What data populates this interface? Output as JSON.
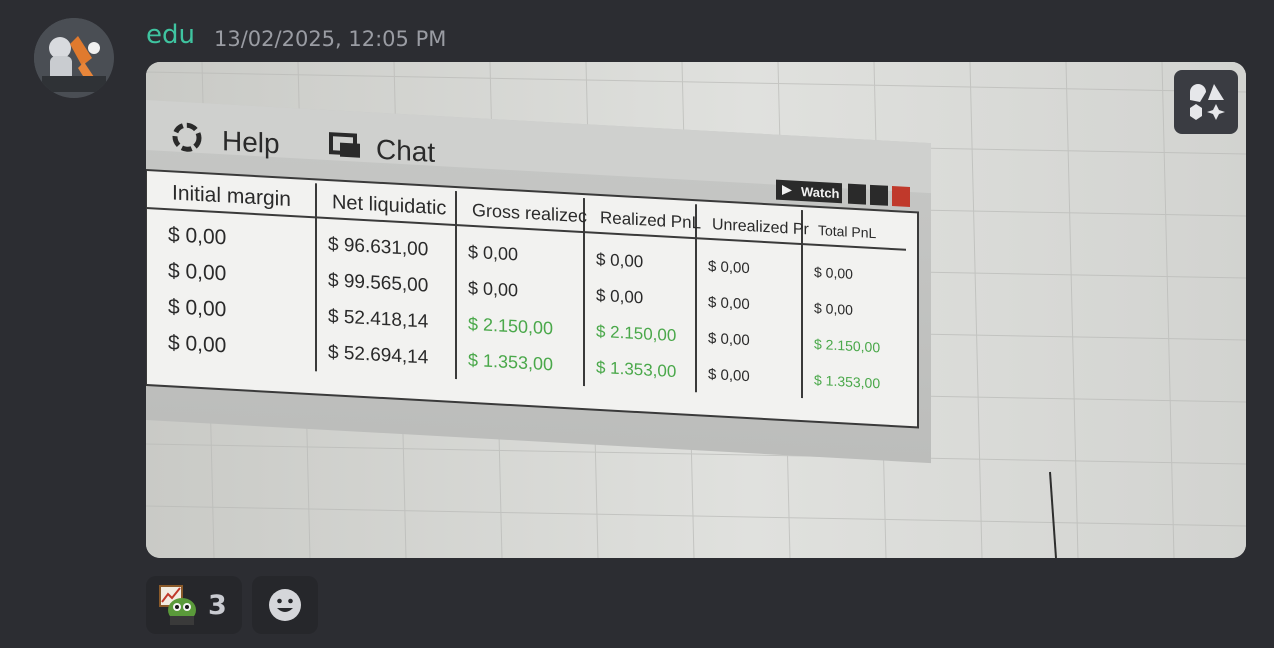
{
  "message": {
    "username": "edu",
    "timestamp": "13/02/2025, 12:05 PM",
    "avatar_icon": "user-avatar"
  },
  "photo": {
    "menu": {
      "help": "Help",
      "chat": "Chat"
    },
    "window_buttons": {
      "watch": "Watch"
    },
    "columns": [
      "Initial margin",
      "Net liquidatic",
      "Gross realizec",
      "Realized PnL",
      "Unrealized Pr",
      "Total PnL"
    ],
    "rows": [
      [
        "$ 0,00",
        "$ 96.631,00",
        "$ 0,00",
        "$ 0,00",
        "$ 0,00",
        "$ 0,00"
      ],
      [
        "$ 0,00",
        "$ 99.565,00",
        "$ 0,00",
        "$ 0,00",
        "$ 0,00",
        "$ 0,00"
      ],
      [
        "$ 0,00",
        "$ 52.418,14",
        "$ 2.150,00",
        "$ 2.150,00",
        "$ 0,00",
        "$ 2.150,00"
      ],
      [
        "$ 0,00",
        "$ 52.694,14",
        "$ 1.353,00",
        "$ 1.353,00",
        "$ 0,00",
        "$ 1.353,00"
      ]
    ],
    "positive_color": "#4aa84a",
    "text_color": "#2a2a2a"
  },
  "reactions": [
    {
      "emoji": "pepe-chart-emoji",
      "count": "3"
    }
  ],
  "icons": {
    "ai_button": "sparkle-shapes-icon",
    "add_reaction": "smiley-icon"
  }
}
